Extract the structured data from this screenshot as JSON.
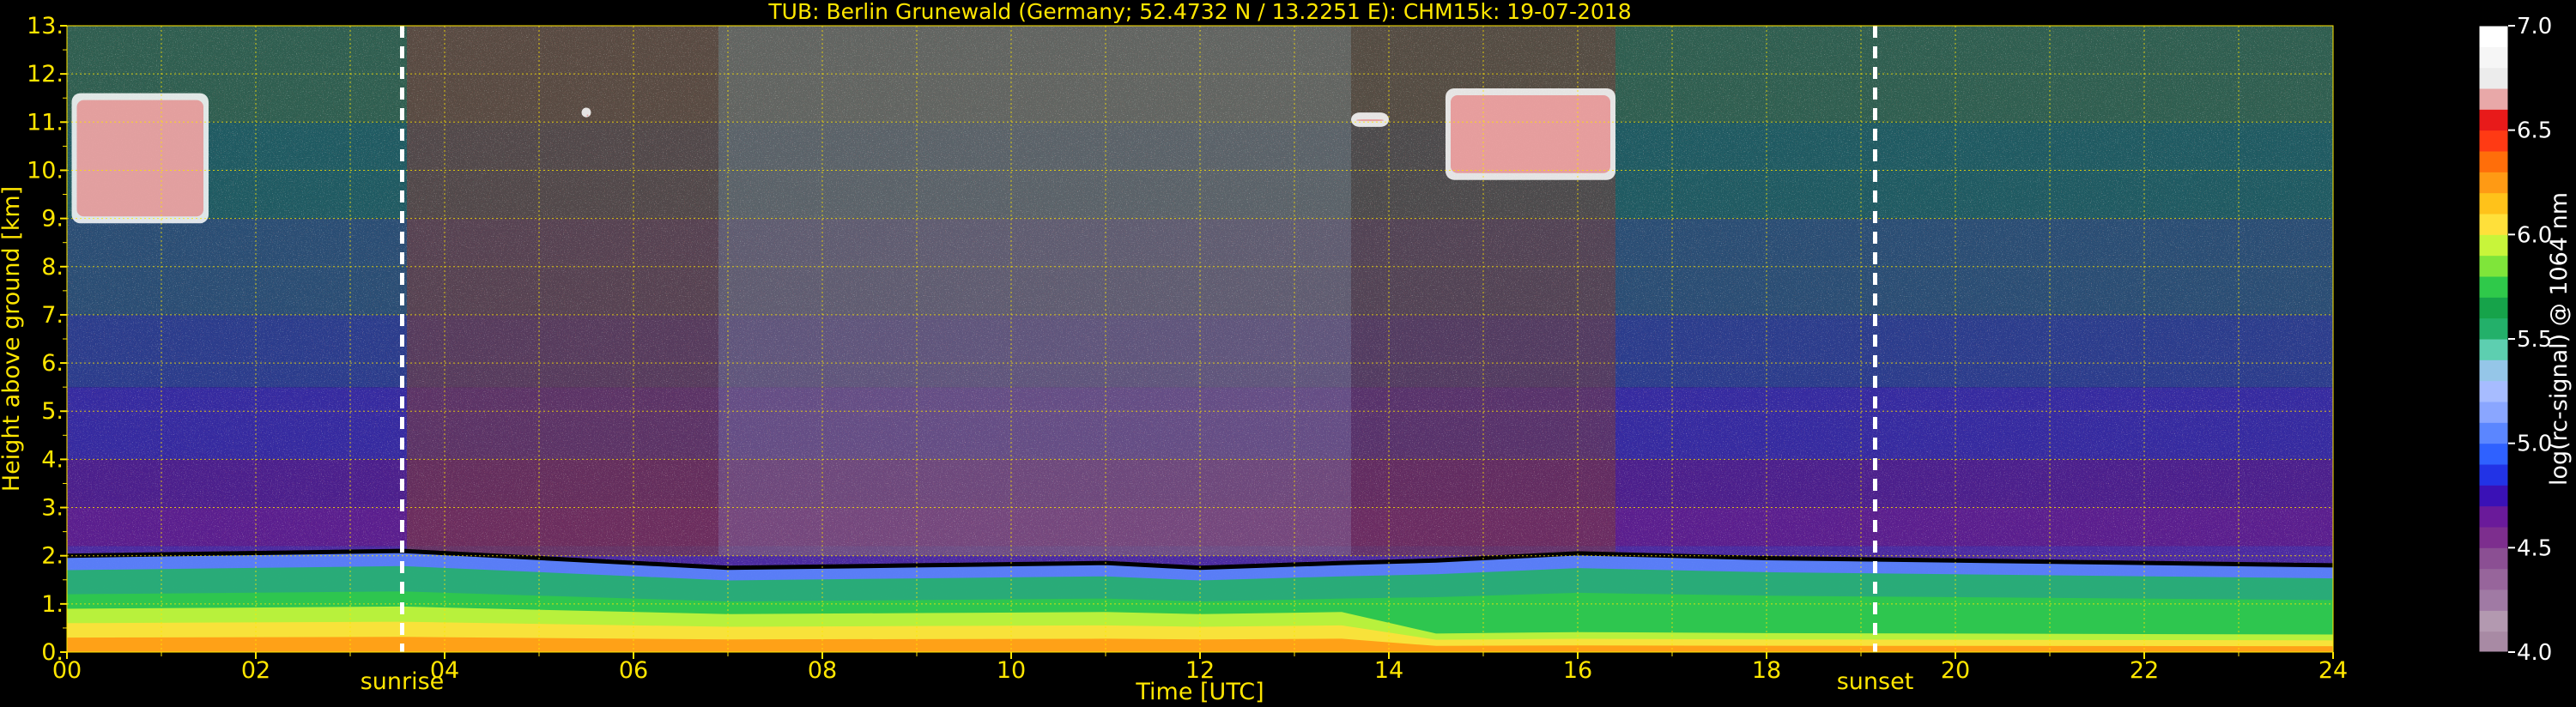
{
  "chart_data": {
    "type": "heatmap",
    "title": "TUB: Berlin Grunewald (Germany; 52.4732 N / 13.2251 E):    CHM15k: 19-07-2018",
    "xlabel": "Time [UTC]",
    "ylabel": "Height above ground [km]",
    "xlim": [
      0,
      24
    ],
    "ylim": [
      0,
      13
    ],
    "x_ticks": [
      "00",
      "02",
      "04",
      "06",
      "08",
      "10",
      "12",
      "14",
      "16",
      "18",
      "20",
      "22",
      "24"
    ],
    "y_ticks": [
      "0.",
      "1.",
      "2.",
      "3.",
      "4.",
      "5.",
      "6.",
      "7.",
      "8.",
      "9.",
      "10.",
      "11.",
      "12.",
      "13."
    ],
    "colorbar": {
      "label": "log(rc-signal) @ 1064 nm",
      "range": [
        4.0,
        7.0
      ],
      "ticks": [
        "4.0",
        "4.5",
        "5.0",
        "5.5",
        "6.0",
        "6.5",
        "7.0"
      ],
      "colors": [
        "#a88aa4",
        "#b399b0",
        "#a07aa4",
        "#97659b",
        "#8b4f93",
        "#7d2e8e",
        "#6a1a9a",
        "#3a11b6",
        "#2233e6",
        "#2f61ff",
        "#5b86ff",
        "#8aa6ff",
        "#a7bcff",
        "#95c6e8",
        "#5dcfb0",
        "#23b06a",
        "#16a34a",
        "#2fc94a",
        "#7fe53a",
        "#c8f53a",
        "#ffe03a",
        "#ffc21a",
        "#ff9a14",
        "#ff6e0a",
        "#ff3a14",
        "#e81a1a",
        "#e8a8a8",
        "#ececec",
        "#f6f6f6",
        "#ffffff"
      ]
    },
    "sunrise": {
      "time": 3.55,
      "label": "sunrise"
    },
    "sunset": {
      "time": 19.15,
      "label": "sunset"
    },
    "grid": true,
    "boundary_layer_top_km": [
      [
        0,
        2.0
      ],
      [
        3.55,
        2.1
      ],
      [
        7.0,
        1.75
      ],
      [
        9.0,
        1.8
      ],
      [
        11.0,
        1.85
      ],
      [
        12.0,
        1.75
      ],
      [
        13.5,
        1.85
      ],
      [
        14.5,
        1.9
      ],
      [
        16.0,
        2.05
      ],
      [
        18.0,
        1.95
      ],
      [
        24,
        1.8
      ]
    ],
    "clouds": [
      {
        "t_start": 0.05,
        "t_end": 1.5,
        "h_bottom": 8.9,
        "h_top": 11.6
      },
      {
        "t_start": 5.45,
        "t_end": 5.55,
        "h_bottom": 11.1,
        "h_top": 11.3
      },
      {
        "t_start": 13.6,
        "t_end": 14.0,
        "h_bottom": 10.9,
        "h_top": 11.2
      },
      {
        "t_start": 14.6,
        "t_end": 16.4,
        "h_bottom": 9.8,
        "h_top": 11.7
      }
    ]
  }
}
